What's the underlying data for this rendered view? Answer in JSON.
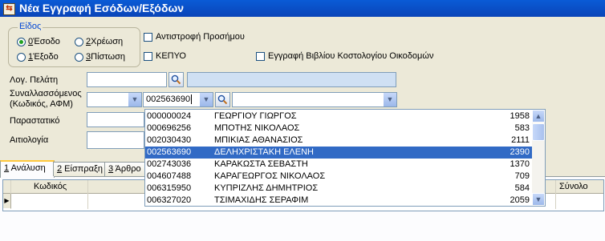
{
  "window": {
    "title": "Νέα Εγγραφή Εσόδων/Εξόδων"
  },
  "eidos": {
    "title": "Είδος",
    "options": [
      {
        "mnemonic": "0",
        "label": " Έσοδο",
        "selected": true
      },
      {
        "mnemonic": "2",
        "label": " Χρέωση",
        "selected": false
      },
      {
        "mnemonic": "1",
        "label": " Έξοδο",
        "selected": false
      },
      {
        "mnemonic": "3",
        "label": " Πίστωση",
        "selected": false
      }
    ]
  },
  "checkboxes": {
    "reverse_sign": "Αντιστροφή Προσήμου",
    "kepyo": "ΚΕΠΥΟ",
    "construction_book": "Εγγραφή Βιβλίου Κοστολογίου Οικοδομών"
  },
  "form": {
    "customer_label": "Λογ. Πελάτη",
    "customer_value": "",
    "counterparty_label_line1": "Συναλλασσόμενος",
    "counterparty_label_line2": "(Κωδικός, ΑΦΜ)",
    "counterparty_code": "002563690",
    "document_label": "Παραστατικό",
    "reason_label": "Αιτιολογία"
  },
  "tabs": [
    {
      "mnemonic": "1",
      "label": " Ανάλυση",
      "active": true
    },
    {
      "mnemonic": "2",
      "label": " Είσπραξη",
      "active": false
    },
    {
      "mnemonic": "3",
      "label": " Άρθρο",
      "active": false
    }
  ],
  "grid": {
    "col_code": "Κωδικός",
    "col_total": "Σύνολο"
  },
  "dropdown_list": [
    {
      "code": "000000024",
      "name": "ΓΕΩΡΓΙΟΥ ΓΙΩΡΓΟΣ",
      "num": "1958"
    },
    {
      "code": "000696256",
      "name": "ΜΠΟΤΗΣ ΝΙΚΟΛΑΟΣ",
      "num": "583"
    },
    {
      "code": "002030430",
      "name": "ΜΠΙΚΙΑΣ ΑΘΑΝΑΣΙΟΣ",
      "num": "2111"
    },
    {
      "code": "002563690",
      "name": "ΔΕΛΗΧΡΙΣΤΑΚΗ ΕΛΕΝΗ",
      "num": "2390",
      "selected": true
    },
    {
      "code": "002743036",
      "name": "ΚΑΡΑΚΩΣΤΑ ΣΕΒΑΣΤΗ",
      "num": "1370"
    },
    {
      "code": "004607488",
      "name": "ΚΑΡΑΓΕΩΡΓΟΣ ΝΙΚΟΛΑΟΣ",
      "num": "709"
    },
    {
      "code": "006315950",
      "name": "ΚΥΠΡΙΖΛΗΣ ΔΗΜΗΤΡΙΟΣ",
      "num": "584"
    },
    {
      "code": "006327020",
      "name": "ΤΣΙΜΑΧΙΔΗΣ ΣΕΡΑΦΙΜ",
      "num": "2059"
    }
  ]
}
